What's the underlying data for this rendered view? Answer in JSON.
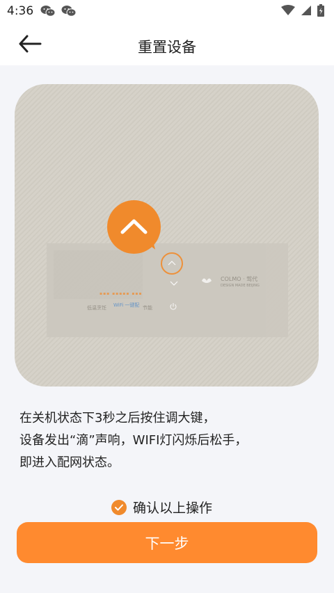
{
  "status_bar": {
    "time": "4:36",
    "icons": [
      "wechat-icon",
      "wechat-icon",
      "wifi-icon",
      "signal-icon",
      "battery-icon"
    ]
  },
  "header": {
    "title": "重置设备",
    "back_icon": "arrow-left-icon"
  },
  "device_panel": {
    "brand_text": "COLMO · 驾代",
    "brand_sub": "DESIGN MADE BEIJING",
    "button_labels": [
      "低温烹饪",
      "WiFi 一键配",
      "节能"
    ]
  },
  "instructions": {
    "lines": [
      "在关机状态下3秒之后按住调大键，",
      "设备发出“滴”声响，WIFI灯闪烁后松手，",
      "即进入配网状态。"
    ]
  },
  "confirm": {
    "label": "确认以上操作",
    "checked": true
  },
  "next_button": {
    "label": "下一步"
  },
  "colors": {
    "accent": "#ff8a2f",
    "background": "#f4f5f9",
    "device_surface": "#d3cfc6"
  }
}
